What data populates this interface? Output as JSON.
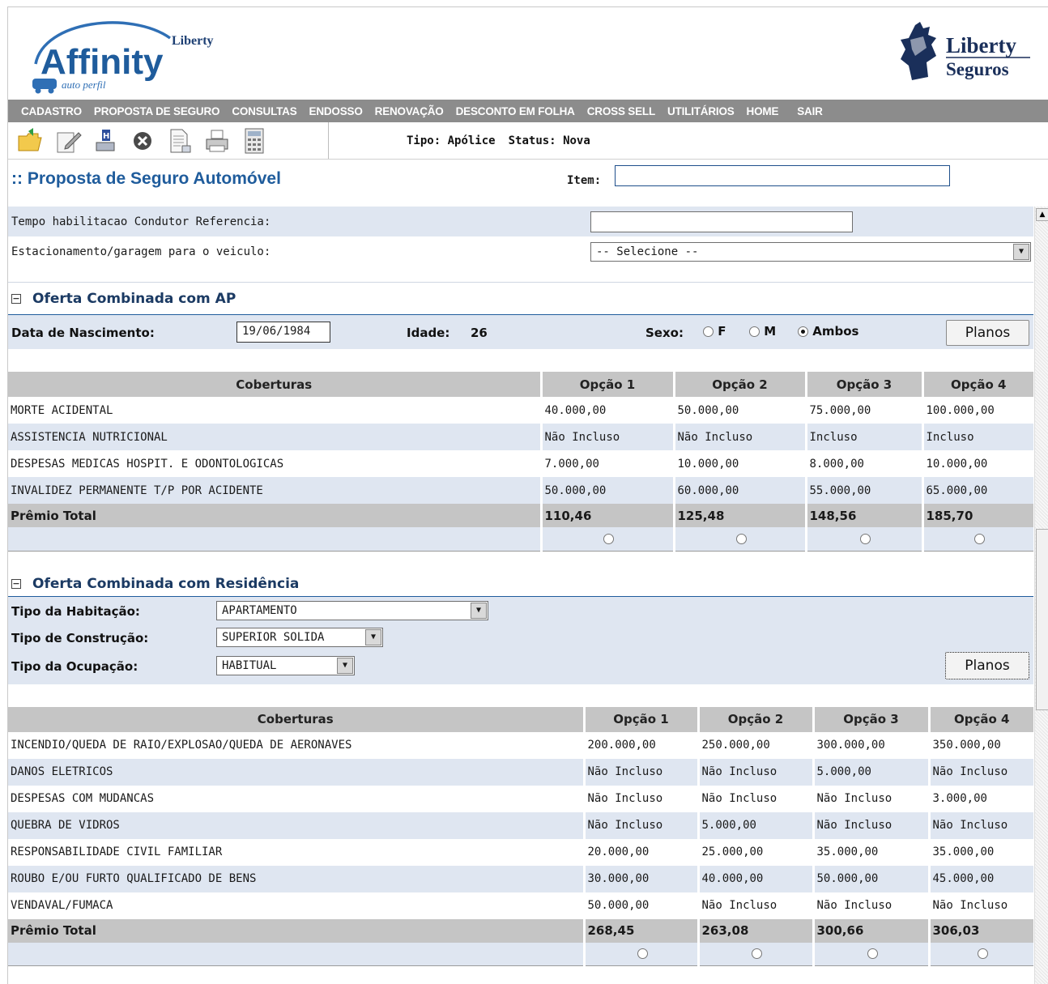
{
  "brand": {
    "left_logo_small": "Liberty",
    "left_logo_main": "Affinity",
    "left_logo_sub": "auto perfil",
    "right_logo_line1": "Liberty",
    "right_logo_line2": "Seguros"
  },
  "menu": [
    "CADASTRO",
    "PROPOSTA DE SEGURO",
    "CONSULTAS",
    "ENDOSSO",
    "RENOVAÇÃO",
    "DESCONTO EM FOLHA",
    "CROSS SELL",
    "UTILITÁRIOS",
    "HOME",
    "SAIR"
  ],
  "toolbar": {
    "icons": [
      "open-folder-icon",
      "edit-icon",
      "save-icon",
      "cancel-icon",
      "document-icon",
      "print-icon",
      "calculator-icon"
    ],
    "tipo_label": "Tipo:",
    "tipo_value": "Apólice",
    "status_label": "Status:",
    "status_value": "Nova"
  },
  "page": {
    "title": ":: Proposta de Seguro Automóvel",
    "item_label": "Item:",
    "item_value": ""
  },
  "form": {
    "tempo_label": "Tempo habilitacao Condutor Referencia:",
    "tempo_value": "",
    "estacionamento_label": "Estacionamento/garagem para o veiculo:",
    "estacionamento_value": "-- Selecione --"
  },
  "ap_section": {
    "title": "Oferta Combinada com AP",
    "toggle": "−",
    "nascimento_label": "Data de Nascimento:",
    "nascimento_value": "19/06/1984",
    "idade_label": "Idade:",
    "idade_value": "26",
    "sexo_label": "Sexo:",
    "sexo_options": [
      "F",
      "M",
      "Ambos"
    ],
    "sexo_selected": "Ambos",
    "planos_button": "Planos",
    "table": {
      "headers": [
        "Coberturas",
        "Opção 1",
        "Opção 2",
        "Opção 3",
        "Opção 4"
      ],
      "rows": [
        [
          "MORTE ACIDENTAL",
          "40.000,00",
          "50.000,00",
          "75.000,00",
          "100.000,00"
        ],
        [
          "ASSISTENCIA NUTRICIONAL",
          "Não Incluso",
          "Não Incluso",
          "Incluso",
          "Incluso"
        ],
        [
          "DESPESAS MEDICAS HOSPIT. E ODONTOLOGICAS",
          "7.000,00",
          "10.000,00",
          "8.000,00",
          "10.000,00"
        ],
        [
          "INVALIDEZ PERMANENTE T/P  POR ACIDENTE",
          "50.000,00",
          "60.000,00",
          "55.000,00",
          "65.000,00"
        ]
      ],
      "total_label": "Prêmio Total",
      "totals": [
        "110,46",
        "125,48",
        "148,56",
        "185,70"
      ]
    }
  },
  "res_section": {
    "title": "Oferta Combinada com Residência",
    "toggle": "−",
    "habitacao_label": "Tipo da Habitação:",
    "habitacao_value": "APARTAMENTO",
    "construcao_label": "Tipo de Construção:",
    "construcao_value": "SUPERIOR SOLIDA",
    "ocupacao_label": "Tipo da Ocupação:",
    "ocupacao_value": "HABITUAL",
    "planos_button": "Planos",
    "table": {
      "headers": [
        "Coberturas",
        "Opção 1",
        "Opção 2",
        "Opção 3",
        "Opção 4"
      ],
      "rows": [
        [
          "INCENDIO/QUEDA DE RAIO/EXPLOSAO/QUEDA DE AERONAVES",
          "200.000,00",
          "250.000,00",
          "300.000,00",
          "350.000,00"
        ],
        [
          "DANOS ELETRICOS",
          "Não Incluso",
          "Não Incluso",
          "5.000,00",
          "Não Incluso"
        ],
        [
          "DESPESAS COM MUDANCAS",
          "Não Incluso",
          "Não Incluso",
          "Não Incluso",
          "3.000,00"
        ],
        [
          "QUEBRA DE VIDROS",
          "Não Incluso",
          "5.000,00",
          "Não Incluso",
          "Não Incluso"
        ],
        [
          "RESPONSABILIDADE CIVIL FAMILIAR",
          "20.000,00",
          "25.000,00",
          "35.000,00",
          "35.000,00"
        ],
        [
          "ROUBO E/OU FURTO QUALIFICADO DE BENS",
          "30.000,00",
          "40.000,00",
          "50.000,00",
          "45.000,00"
        ],
        [
          "VENDAVAL/FUMACA",
          "50.000,00",
          "Não Incluso",
          "Não Incluso",
          "Não Incluso"
        ]
      ],
      "total_label": "Prêmio Total",
      "totals": [
        "268,45",
        "263,08",
        "300,66",
        "306,03"
      ]
    }
  },
  "colors": {
    "menu_bg": "#8c8c8c",
    "title_blue": "#1f5c9c",
    "row_blue": "#dfe6f1",
    "header_gray": "#c5c5c5"
  }
}
